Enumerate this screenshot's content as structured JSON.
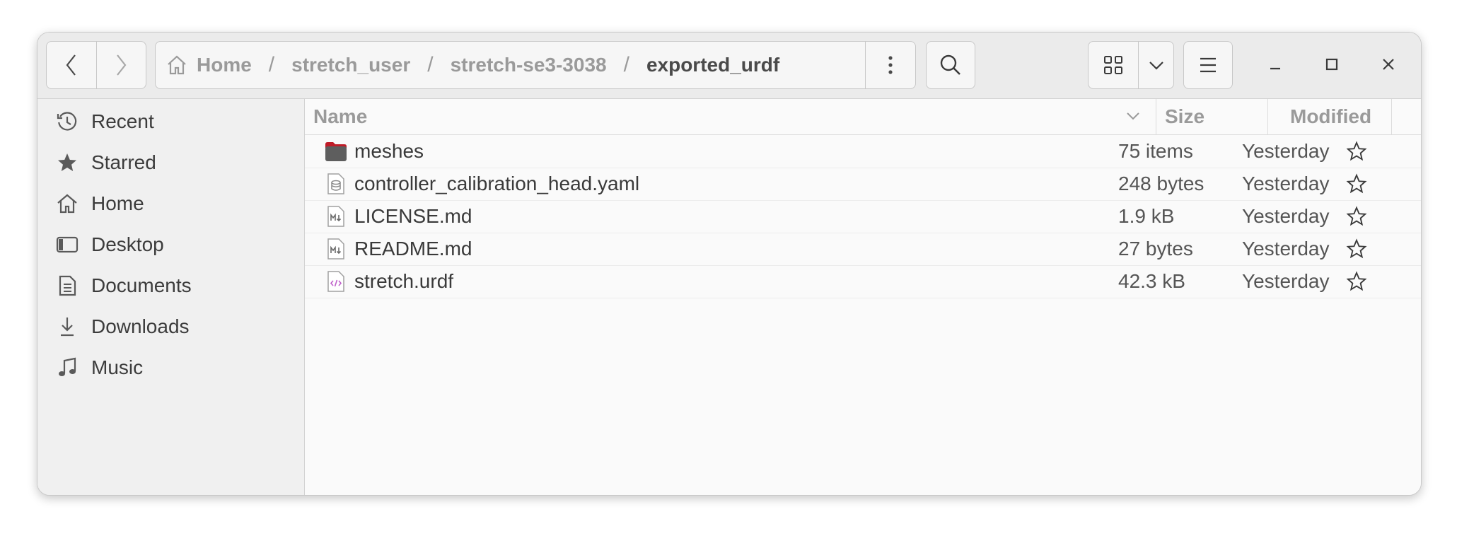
{
  "path": {
    "crumbs": [
      "Home",
      "stretch_user",
      "stretch-se3-3038",
      "exported_urdf"
    ],
    "separator": "/"
  },
  "sidebar": {
    "items": [
      {
        "label": "Recent",
        "icon": "clock-icon"
      },
      {
        "label": "Starred",
        "icon": "star-icon"
      },
      {
        "label": "Home",
        "icon": "home-icon"
      },
      {
        "label": "Desktop",
        "icon": "desktop-icon"
      },
      {
        "label": "Documents",
        "icon": "document-icon"
      },
      {
        "label": "Downloads",
        "icon": "download-icon"
      },
      {
        "label": "Music",
        "icon": "music-icon"
      }
    ]
  },
  "columns": {
    "name": "Name",
    "size": "Size",
    "modified": "Modified"
  },
  "files": [
    {
      "name": "meshes",
      "size": "75 items",
      "modified": "Yesterday",
      "icon": "folder-icon"
    },
    {
      "name": "controller_calibration_head.yaml",
      "size": "248 bytes",
      "modified": "Yesterday",
      "icon": "database-file-icon"
    },
    {
      "name": "LICENSE.md",
      "size": "1.9 kB",
      "modified": "Yesterday",
      "icon": "markdown-file-icon"
    },
    {
      "name": "README.md",
      "size": "27 bytes",
      "modified": "Yesterday",
      "icon": "markdown-file-icon"
    },
    {
      "name": "stretch.urdf",
      "size": "42.3 kB",
      "modified": "Yesterday",
      "icon": "code-file-icon"
    }
  ],
  "colors": {
    "headerbar": "#ebebeb",
    "sidebar": "#f0f0f0",
    "folder": "#5e5e5e",
    "folder_tab": "#c01c28",
    "code_icon": "#c061cb"
  }
}
